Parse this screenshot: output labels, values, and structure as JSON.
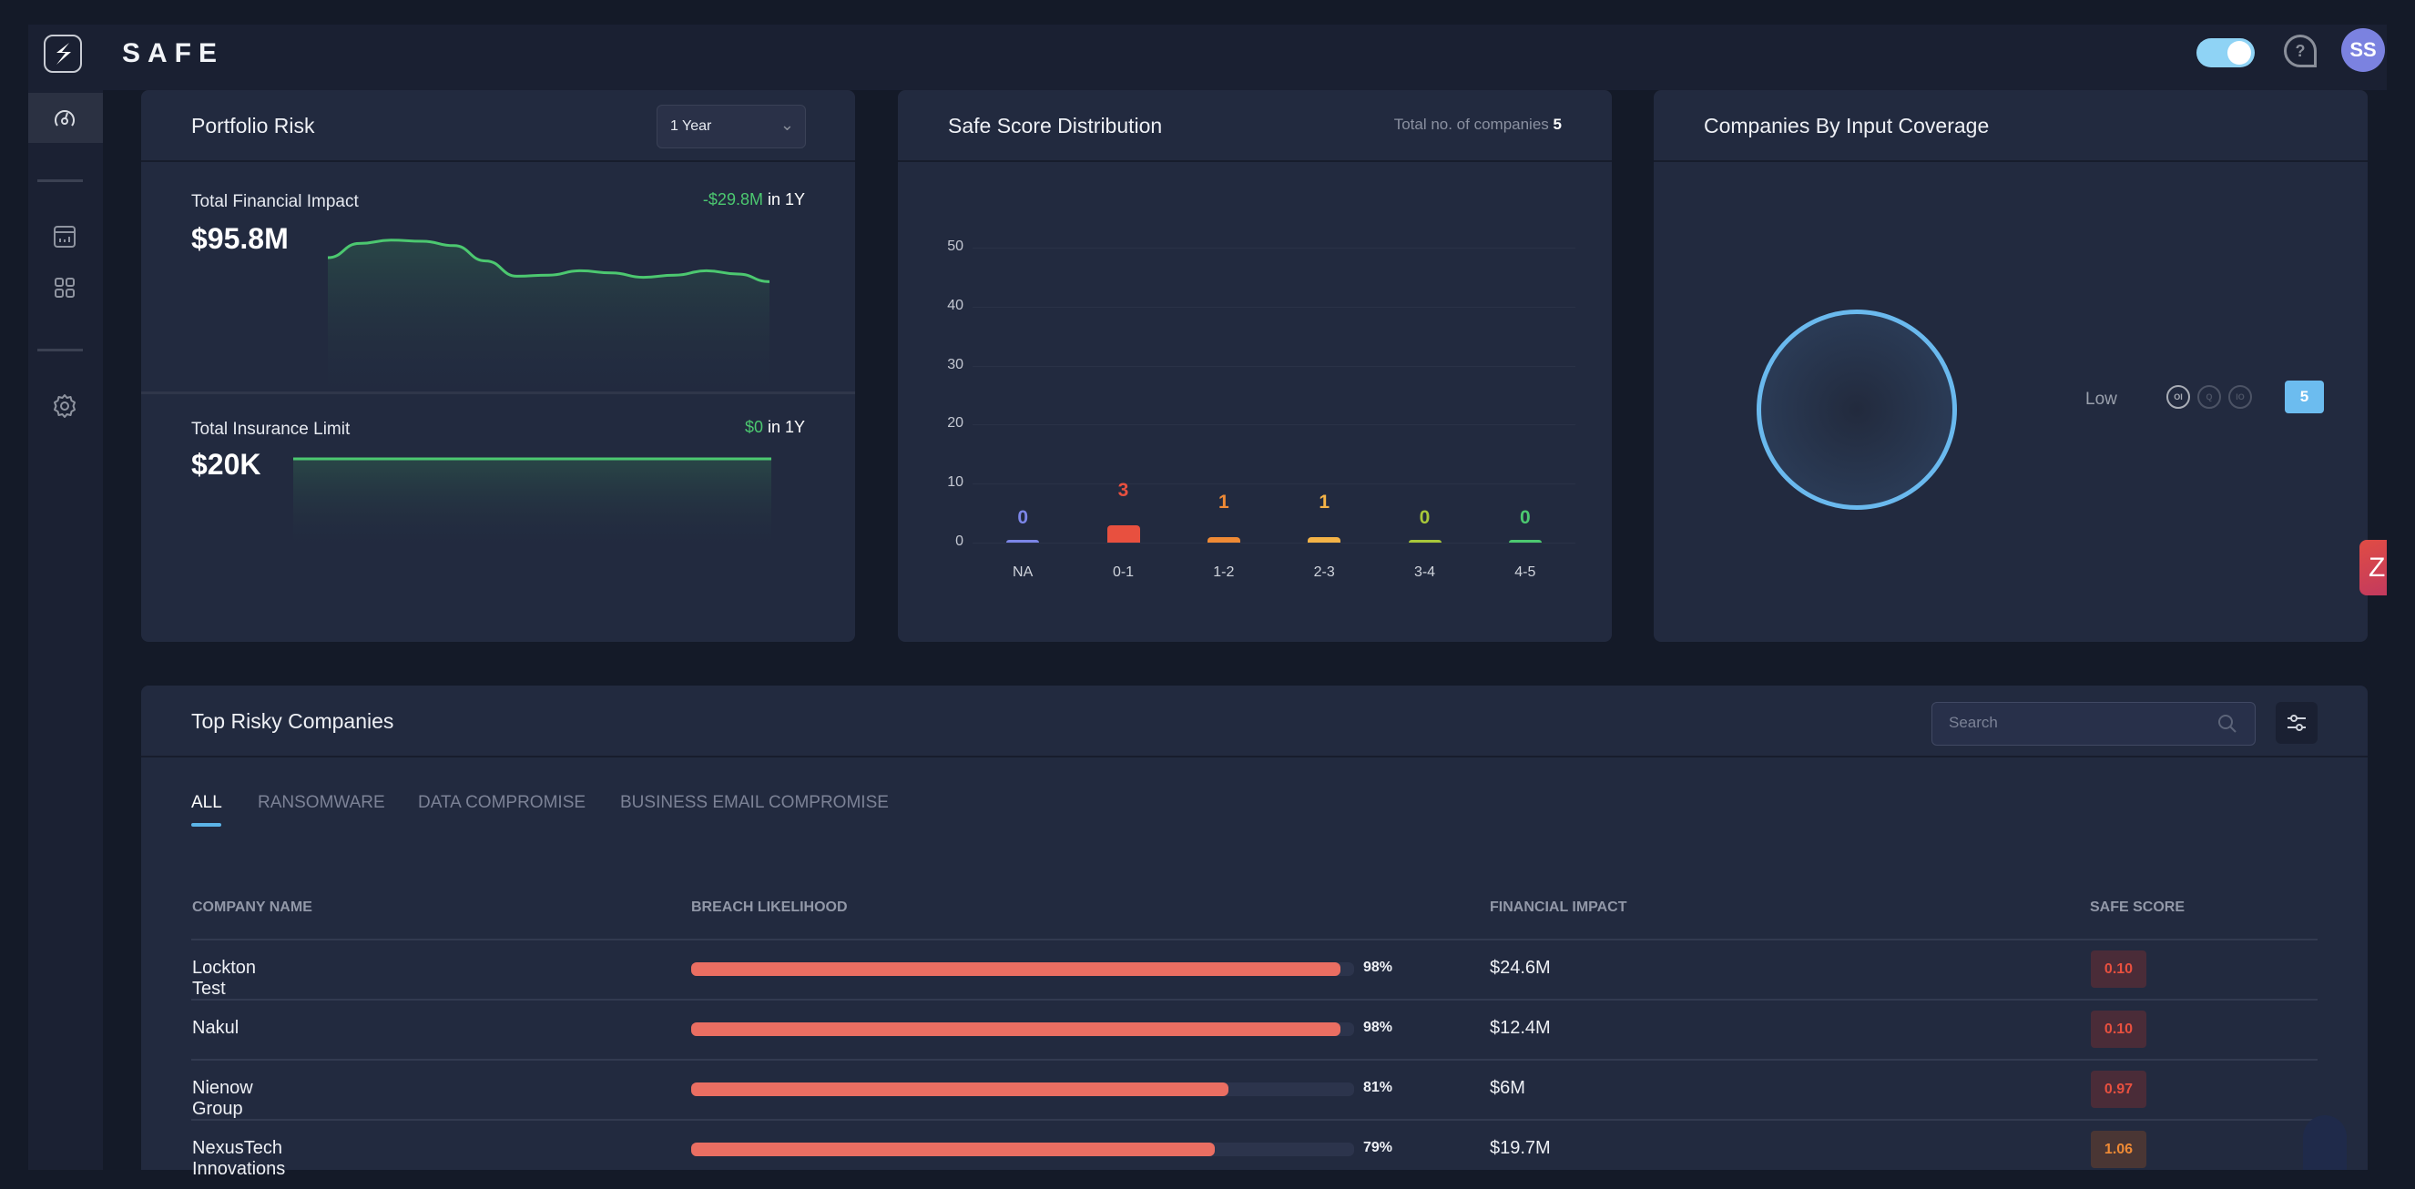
{
  "app": {
    "brand": "SAFE",
    "avatar_initials": "SS",
    "side_tab_glyph": "Z"
  },
  "colors": {
    "accent": "#6cbcef",
    "positive": "#4cc870",
    "risk_red": "#ea6e62",
    "avatar": "#7b82e0"
  },
  "sidebar": {
    "items": [
      {
        "name": "dashboard",
        "icon": "gauge-icon",
        "active": true
      },
      {
        "name": "reports",
        "icon": "calendar-chart-icon",
        "active": false
      },
      {
        "name": "apps",
        "icon": "grid-icon",
        "active": false
      },
      {
        "name": "settings",
        "icon": "gear-icon",
        "active": false
      }
    ]
  },
  "portfolio_risk": {
    "title": "Portfolio Risk",
    "period_select": "1 Year",
    "financial_impact": {
      "label": "Total Financial Impact",
      "value": "$95.8M",
      "delta": "-$29.8M",
      "delta_suffix": " in 1Y",
      "trend": [
        55,
        68,
        71,
        70,
        66,
        52,
        38,
        39,
        43,
        41,
        37,
        39,
        43,
        40,
        33
      ]
    },
    "insurance_limit": {
      "label": "Total Insurance Limit",
      "value": "$20K",
      "delta": "$0",
      "delta_suffix": " in 1Y",
      "trend": [
        50,
        50,
        50,
        50,
        50,
        50,
        50,
        50
      ]
    }
  },
  "safe_score": {
    "title": "Safe Score Distribution",
    "total_label": "Total no. of companies",
    "total_value": "5"
  },
  "chart_data": {
    "type": "bar",
    "title": "Safe Score Distribution",
    "categories": [
      "NA",
      "0-1",
      "1-2",
      "2-3",
      "3-4",
      "4-5"
    ],
    "values": [
      0,
      3,
      1,
      1,
      0,
      0
    ],
    "colors": [
      "#7c86e8",
      "#e8503f",
      "#ef8a35",
      "#f4b347",
      "#a8c73a",
      "#4cc870"
    ],
    "yticks": [
      0,
      10,
      20,
      30,
      40,
      50
    ],
    "ylim": [
      0,
      50
    ],
    "xlabel": "",
    "ylabel": "",
    "grid": true
  },
  "coverage": {
    "title": "Companies By Input Coverage",
    "legend_label": "Low",
    "sources": [
      {
        "label": "OI",
        "active": true
      },
      {
        "label": "Q",
        "active": false
      },
      {
        "label": "IO",
        "active": false
      }
    ],
    "count": "5"
  },
  "top_risky": {
    "title": "Top Risky Companies",
    "search_placeholder": "Search",
    "tabs": [
      "ALL",
      "RANSOMWARE",
      "DATA COMPROMISE",
      "BUSINESS EMAIL COMPROMISE"
    ],
    "active_tab": 0,
    "columns": [
      "COMPANY NAME",
      "BREACH LIKELIHOOD",
      "FINANCIAL IMPACT",
      "SAFE SCORE"
    ],
    "rows": [
      {
        "company": "Lockton Test",
        "likelihood": 98,
        "likelihood_label": "98%",
        "impact": "$24.6M",
        "score": "0.10",
        "score_color": "#e8503f",
        "score_bg": "#4a2c38"
      },
      {
        "company": "Nakul",
        "likelihood": 98,
        "likelihood_label": "98%",
        "impact": "$12.4M",
        "score": "0.10",
        "score_color": "#e8503f",
        "score_bg": "#4a2c38"
      },
      {
        "company": "Nienow Group",
        "likelihood": 81,
        "likelihood_label": "81%",
        "impact": "$6M",
        "score": "0.97",
        "score_color": "#e8503f",
        "score_bg": "#4a2c38"
      },
      {
        "company": "NexusTech Innovations",
        "likelihood": 79,
        "likelihood_label": "79%",
        "impact": "$19.7M",
        "score": "1.06",
        "score_color": "#ef8a35",
        "score_bg": "#4a3634"
      }
    ]
  }
}
